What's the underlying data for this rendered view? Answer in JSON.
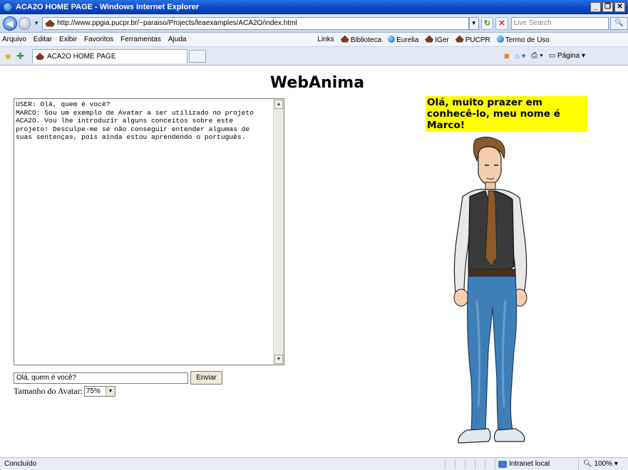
{
  "window": {
    "title": "ACA2O HOME PAGE - Windows Internet Explorer",
    "controls": [
      "_",
      "❐",
      "✕"
    ]
  },
  "address_bar": {
    "url": "http://www.ppgia.pucpr.br/~paraiso/Projects/leaexamples/ACA2O/index.html",
    "search_placeholder": "Live Search"
  },
  "menu": {
    "items": [
      "Arquivo",
      "Editar",
      "Exibir",
      "Favoritos",
      "Ferramentas",
      "Ajuda"
    ],
    "links_label": "Links",
    "links": [
      "Biblioteca",
      "Eurelia",
      "IGer",
      "PUCPR",
      "Termo de Uso"
    ]
  },
  "tabs": {
    "active_label": "ACA2O HOME PAGE",
    "page_menu": "Página"
  },
  "page": {
    "title": "WebAnima",
    "chat_log": "USER: Olá, quem é você?\nMARCO: Sou um exemplo de Avatar a ser utilizado no projeto\nACA2O. Vou lhe introduzir alguns conceitos sobre este\nprojeto! Desculpe-me se não conseguir entender algumas de\nsuas sentenças, pois ainda estou aprendendo o português.",
    "input_value": "Olá, quem é você?",
    "send_label": "Enviar",
    "size_label": "Tamanho do Avatar:",
    "size_value": "75%",
    "speech": "Olá, muito prazer em conhecê-lo, meu nome é Marco!"
  },
  "status_bar": {
    "text": "Concluído",
    "zone": "Intranet local",
    "zoom": "100%"
  }
}
